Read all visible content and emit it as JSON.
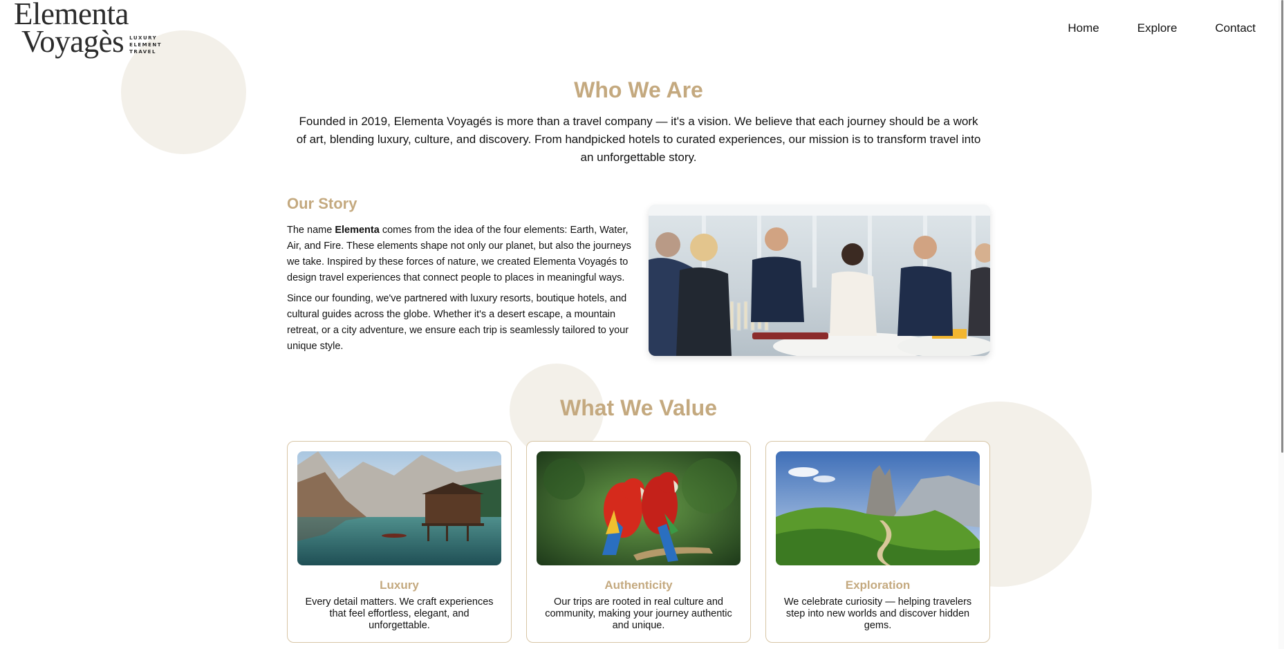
{
  "brand": {
    "name_line1": "Elementa",
    "name_line2": "Voyagès",
    "tagline_1": "LUXURY",
    "tagline_2": "ELEMENT",
    "tagline_3": "TRAVEL"
  },
  "nav": {
    "items": [
      {
        "label": "Home"
      },
      {
        "label": "Explore"
      },
      {
        "label": "Contact"
      }
    ]
  },
  "about": {
    "title": "Who We Are",
    "intro": "Founded in 2019, Elementa Voyagés is more than a travel company — it's a vision. We believe that each journey should be a work of art, blending luxury, culture, and discovery. From handpicked hotels to curated experiences, our mission is to transform travel into an unforgettable story."
  },
  "story": {
    "title": "Our Story",
    "p1_before": "The name ",
    "p1_bold": "Elementa",
    "p1_after": " comes from the idea of the four elements: Earth, Water, Air, and Fire. These elements shape not only our planet, but also the journeys we take. Inspired by these forces of nature, we created Elementa Voyagés to design travel experiences that connect people to places in meaningful ways.",
    "p2": "Since our founding, we've partnered with luxury resorts, boutique hotels, and cultural guides across the globe. Whether it's a desert escape, a mountain retreat, or a city adventure, we ensure each trip is seamlessly tailored to your unique style."
  },
  "values": {
    "title": "What We Value",
    "cards": [
      {
        "title": "Luxury",
        "text": "Every detail matters. We craft experiences that feel effortless, elegant, and unforgettable."
      },
      {
        "title": "Authenticity",
        "text": "Our trips are rooted in real culture and community, making your journey authentic and unique."
      },
      {
        "title": "Exploration",
        "text": "We celebrate curiosity — helping travelers step into new worlds and discover hidden gems."
      }
    ]
  },
  "colors": {
    "accent": "#c4a97f",
    "circle": "#f3f0e9",
    "card_border": "#d7c5a5",
    "text": "#111111"
  }
}
